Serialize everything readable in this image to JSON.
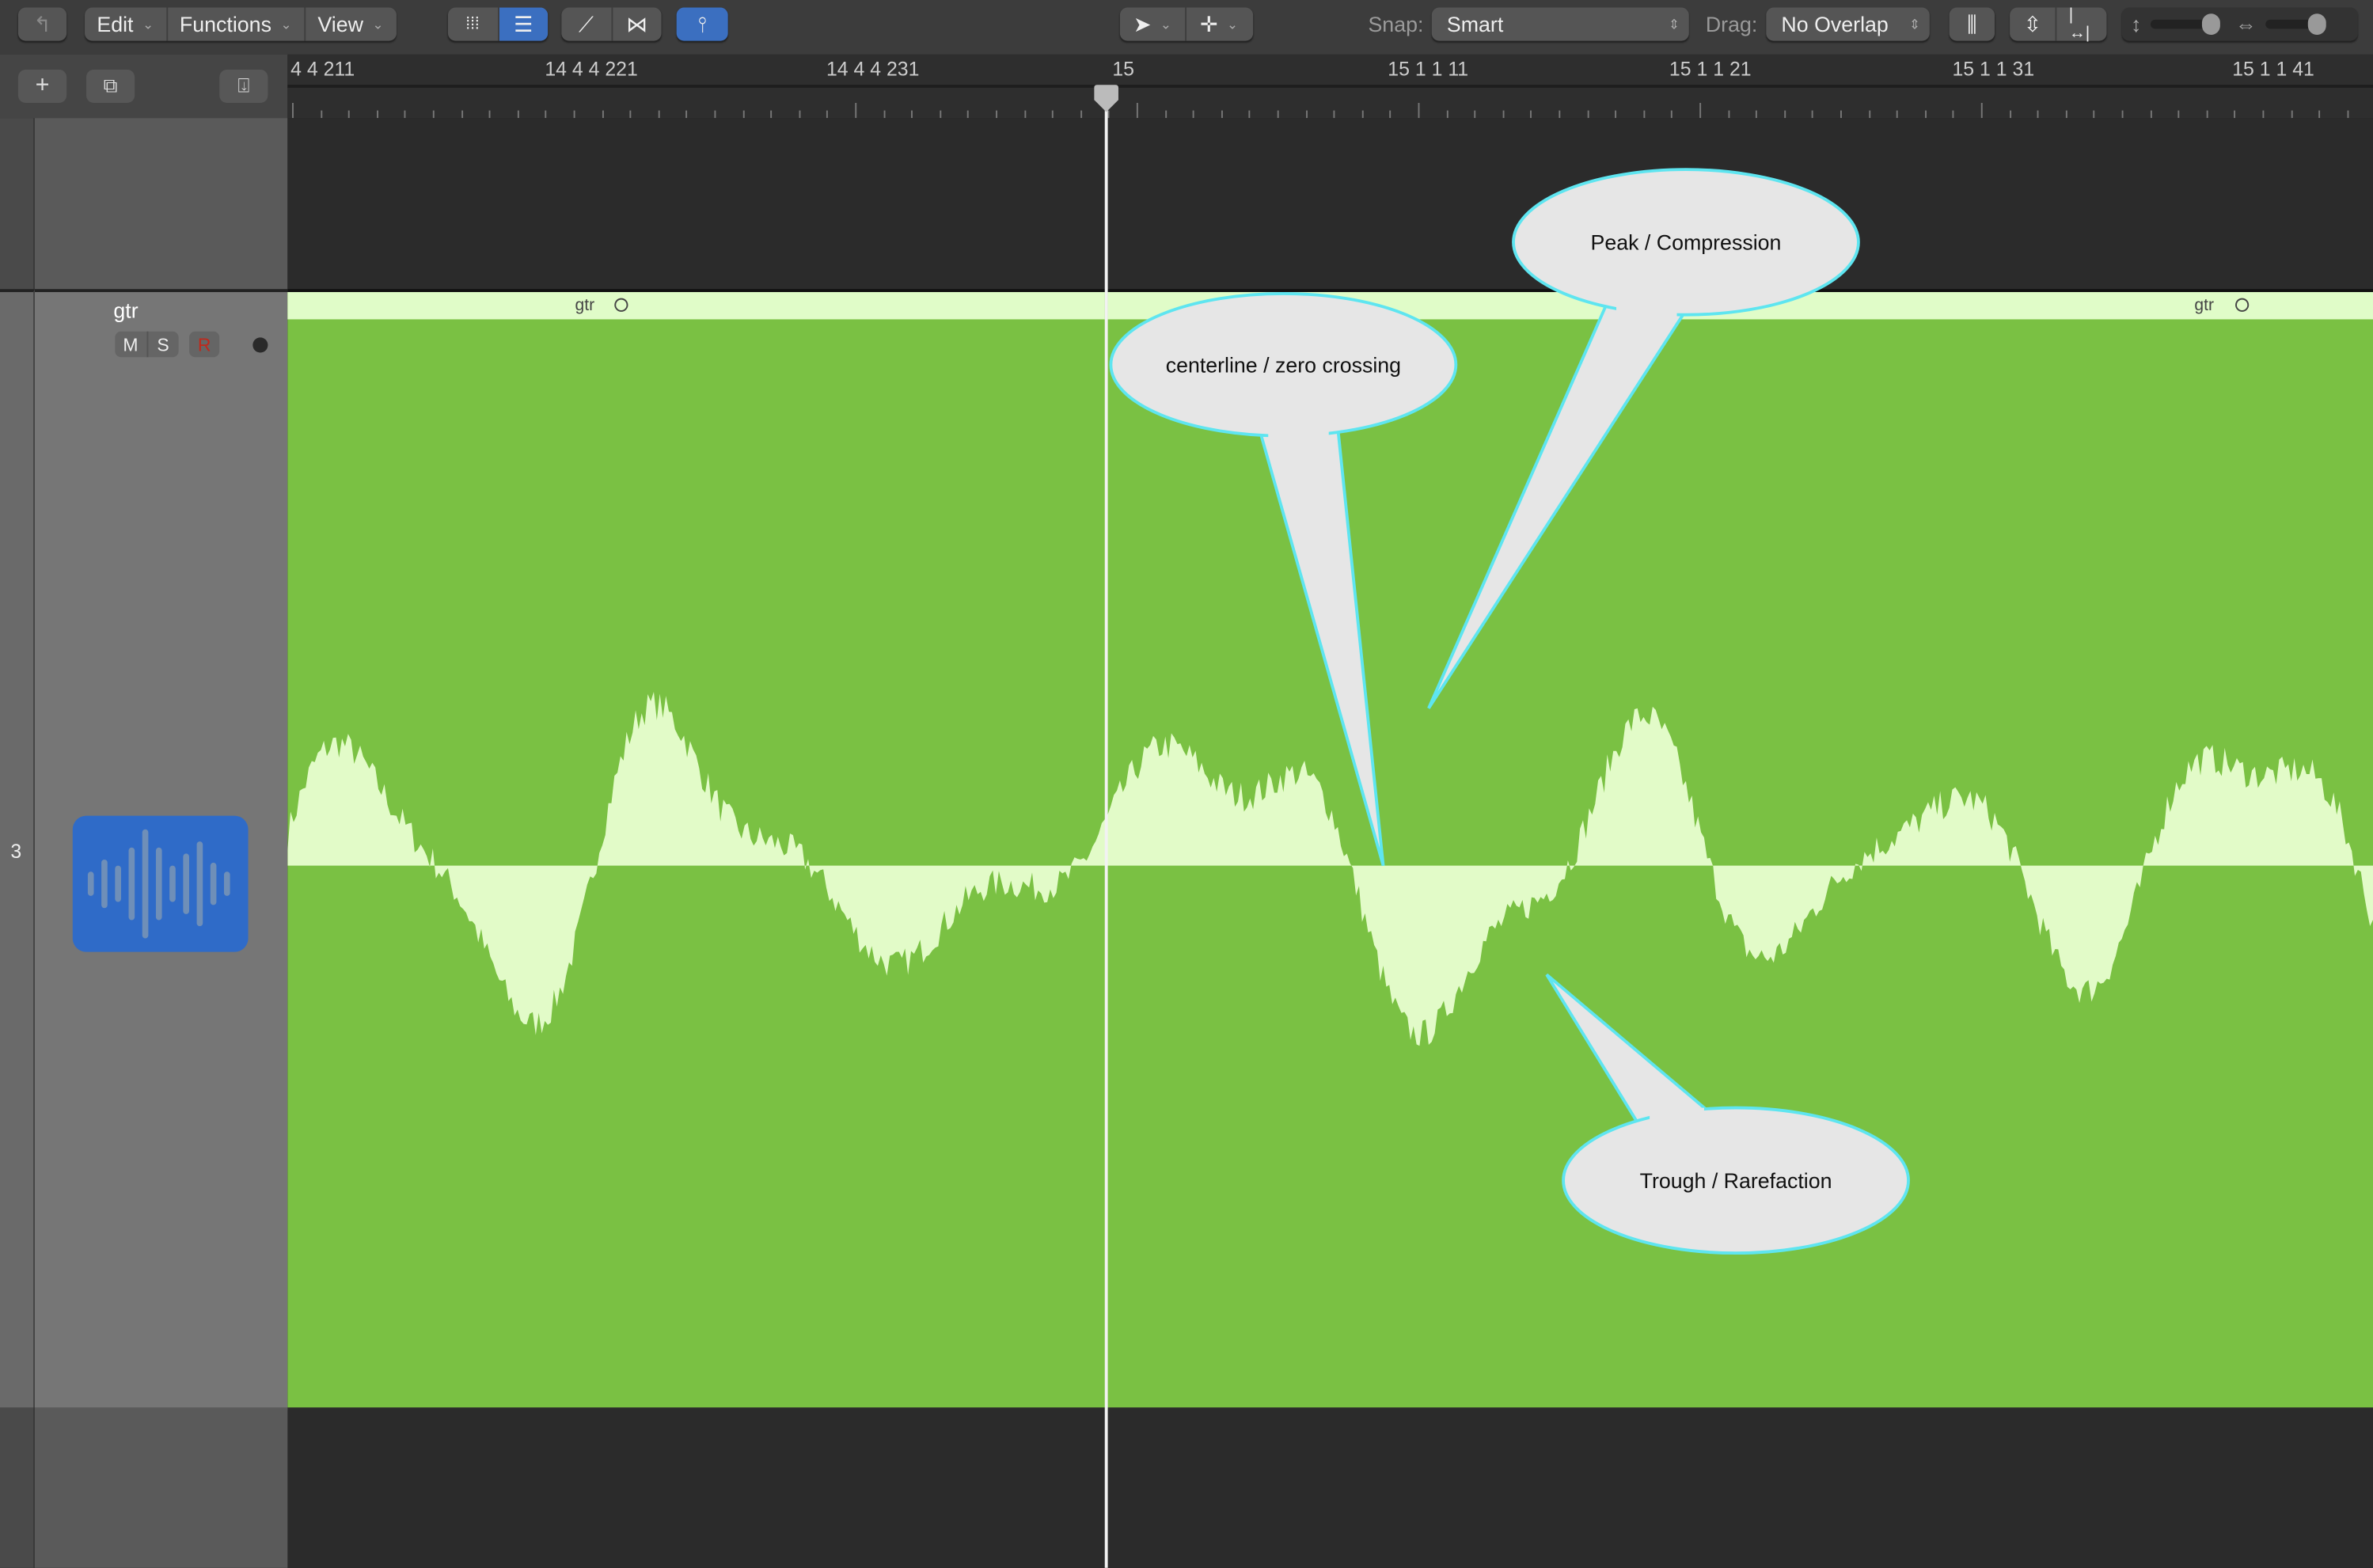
{
  "toolbar": {
    "back_icon": "back-arrow-icon",
    "menus": [
      {
        "label": "Edit"
      },
      {
        "label": "Functions"
      },
      {
        "label": "View"
      }
    ],
    "snap_label": "Snap:",
    "snap_value": "Smart",
    "drag_label": "Drag:",
    "drag_value": "No Overlap",
    "accent": "#3b6fc0"
  },
  "ruler": {
    "labels": [
      "4 4 211",
      "14 4 4 221",
      "14 4 4 231",
      "15",
      "15 1 1 11",
      "15 1 1 21",
      "15 1 1 31",
      "15 1 1 41"
    ]
  },
  "track": {
    "number": "3",
    "name": "gtr",
    "mute": "M",
    "solo": "S",
    "record": "R",
    "region_name_left": "gtr",
    "region_name_right": "gtr",
    "region_color": "#7ac143",
    "waveform_color": "#e2fbc8"
  },
  "callouts": {
    "peak": "Peak / Compression",
    "zero": "centerline / zero crossing",
    "trough": "Trough / Rarefaction",
    "stroke_color": "#5ee5f0"
  }
}
